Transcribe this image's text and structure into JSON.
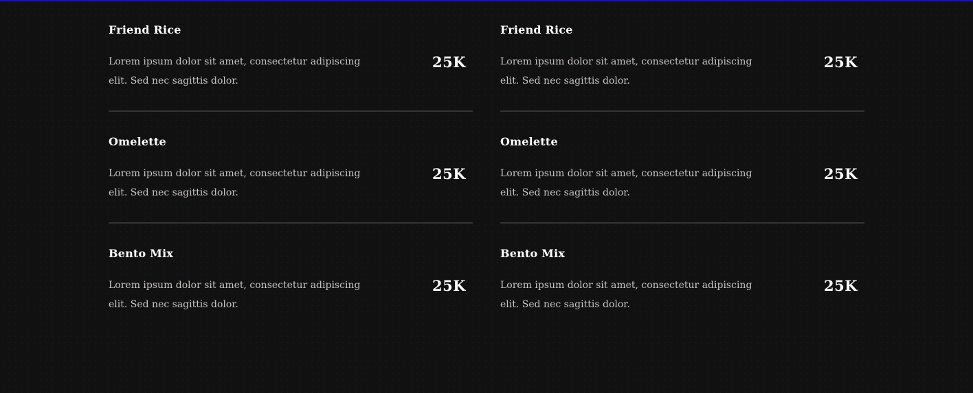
{
  "accent_color": "#1c15a8",
  "columns": [
    {
      "items": [
        {
          "name": "Friend Rice",
          "description": "Lorem ipsum dolor sit amet, consectetur adipiscing elit. Sed nec sagittis dolor.",
          "price": "25K"
        },
        {
          "name": "Omelette",
          "description": "Lorem ipsum dolor sit amet, consectetur adipiscing elit. Sed nec sagittis dolor.",
          "price": "25K"
        },
        {
          "name": "Bento Mix",
          "description": "Lorem ipsum dolor sit amet, consectetur adipiscing elit. Sed nec sagittis dolor.",
          "price": "25K"
        }
      ]
    },
    {
      "items": [
        {
          "name": "Friend Rice",
          "description": "Lorem ipsum dolor sit amet, consectetur adipiscing elit. Sed nec sagittis dolor.",
          "price": "25K"
        },
        {
          "name": "Omelette",
          "description": "Lorem ipsum dolor sit amet, consectetur adipiscing elit. Sed nec sagittis dolor.",
          "price": "25K"
        },
        {
          "name": "Bento Mix",
          "description": "Lorem ipsum dolor sit amet, consectetur adipiscing elit. Sed nec sagittis dolor.",
          "price": "25K"
        }
      ]
    }
  ]
}
